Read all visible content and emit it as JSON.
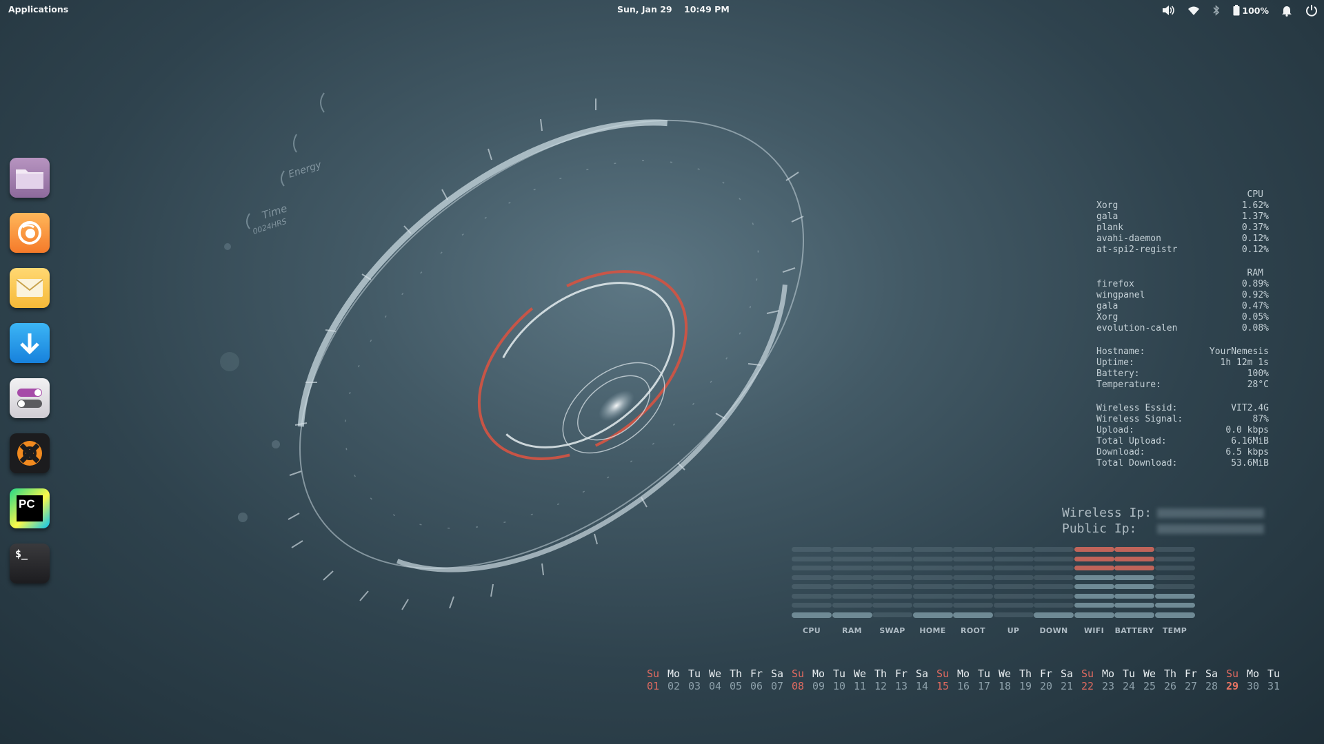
{
  "topbar": {
    "applications_label": "Applications",
    "datetime": "Sun, Jan 29    10:49 PM",
    "battery_percent": "100%",
    "tray_icons": [
      "volume-icon",
      "wifi-icon",
      "bluetooth-icon",
      "battery-icon",
      "notification-bell-icon",
      "power-icon"
    ]
  },
  "dock": {
    "items": [
      {
        "name": "files",
        "icon": "folder-icon"
      },
      {
        "name": "firefox",
        "icon": "firefox-icon"
      },
      {
        "name": "mail",
        "icon": "mail-icon"
      },
      {
        "name": "appcenter",
        "icon": "download-arrow-icon"
      },
      {
        "name": "settings",
        "icon": "toggle-switches-icon"
      },
      {
        "name": "crossover",
        "icon": "crossover-icon"
      },
      {
        "name": "pycharm",
        "icon": "pycharm-icon"
      },
      {
        "name": "terminal",
        "icon": "terminal-icon"
      }
    ],
    "pycharm_text": "PC",
    "terminal_text": "$_"
  },
  "hud": {
    "label_time": "Time",
    "label_time_value": "0024HRS",
    "label_energy": "Energy"
  },
  "conky": {
    "cpu_header": "CPU",
    "cpu_procs": [
      {
        "name": "Xorg",
        "value": "1.62%"
      },
      {
        "name": "gala",
        "value": "1.37%"
      },
      {
        "name": "plank",
        "value": "0.37%"
      },
      {
        "name": "avahi-daemon",
        "value": "0.12%"
      },
      {
        "name": "at-spi2-registr",
        "value": "0.12%"
      }
    ],
    "ram_header": "RAM",
    "ram_procs": [
      {
        "name": "firefox",
        "value": "0.89%"
      },
      {
        "name": "wingpanel",
        "value": "0.92%"
      },
      {
        "name": "gala",
        "value": "0.47%"
      },
      {
        "name": "Xorg",
        "value": "0.05%"
      },
      {
        "name": "evolution-calen",
        "value": "0.08%"
      }
    ],
    "system": [
      {
        "label": "Hostname:",
        "value": "YourNemesis"
      },
      {
        "label": "Uptime:",
        "value": "1h 12m 1s"
      },
      {
        "label": "Battery:",
        "value": "100%"
      },
      {
        "label": "Temperature:",
        "value": "28°C"
      }
    ],
    "network": [
      {
        "label": "Wireless Essid:",
        "value": "VIT2.4G"
      },
      {
        "label": "Wireless Signal:",
        "value": "87%"
      },
      {
        "label": "Upload:",
        "value": "0.0 kbps"
      },
      {
        "label": "Total Upload:",
        "value": "6.16MiB"
      },
      {
        "label": "Download:",
        "value": "6.5 kbps"
      },
      {
        "label": "Total Download:",
        "value": "53.6MiB"
      }
    ],
    "wireless_ip_label": "Wireless Ip:",
    "public_ip_label": "Public Ip:"
  },
  "meters": [
    {
      "label": "CPU",
      "level": 1,
      "color": "#6f8a95"
    },
    {
      "label": "RAM",
      "level": 1,
      "color": "#6f8a95"
    },
    {
      "label": "SWAP",
      "level": 0,
      "color": "#6f8a95"
    },
    {
      "label": "HOME",
      "level": 1,
      "color": "#6f8a95"
    },
    {
      "label": "ROOT",
      "level": 1,
      "color": "#6f8a95"
    },
    {
      "label": "UP",
      "level": 0,
      "color": "#6f8a95"
    },
    {
      "label": "DOWN",
      "level": 1,
      "color": "#6f8a95"
    },
    {
      "label": "WIFI",
      "level": 8,
      "color": "#6f8a95"
    },
    {
      "label": "BATTERY",
      "level": 8,
      "color": "#6f8a95"
    },
    {
      "label": "TEMP",
      "level": 3,
      "color": "#6f8a95"
    }
  ],
  "meter_segments": 8,
  "meter_hot_color": "#c0645a",
  "calendar": {
    "days": [
      "Su",
      "Mo",
      "Tu",
      "We",
      "Th",
      "Fr",
      "Sa",
      "Su",
      "Mo",
      "Tu",
      "We",
      "Th",
      "Fr",
      "Sa",
      "Su",
      "Mo",
      "Tu",
      "We",
      "Th",
      "Fr",
      "Sa",
      "Su",
      "Mo",
      "Tu",
      "We",
      "Th",
      "Fr",
      "Sa",
      "Su",
      "Mo",
      "Tu"
    ],
    "dates": [
      "01",
      "02",
      "03",
      "04",
      "05",
      "06",
      "07",
      "08",
      "09",
      "10",
      "11",
      "12",
      "13",
      "14",
      "15",
      "16",
      "17",
      "18",
      "19",
      "20",
      "21",
      "22",
      "23",
      "24",
      "25",
      "26",
      "27",
      "28",
      "29",
      "30",
      "31"
    ],
    "today": "29"
  }
}
